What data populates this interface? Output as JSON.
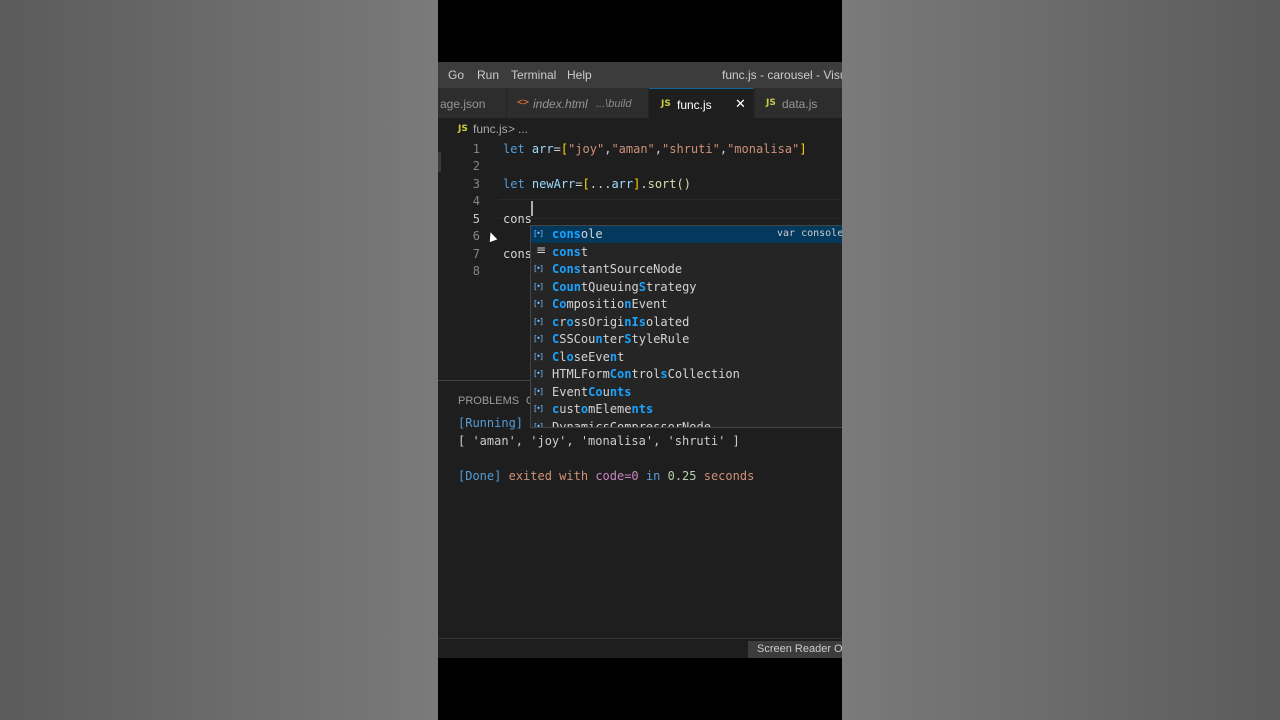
{
  "menubar": {
    "items": [
      "Go",
      "Run",
      "Terminal",
      "Help"
    ],
    "window_title": "func.js - carousel - Visual S"
  },
  "tabs": [
    {
      "label": "age.json",
      "description": "",
      "icon": "json-icon",
      "active": false
    },
    {
      "label": "index.html",
      "description": "...\\build",
      "icon": "html-icon",
      "active": false
    },
    {
      "label": "func.js",
      "description": "",
      "icon": "js-icon",
      "active": true
    },
    {
      "label": "data.js",
      "description": "",
      "icon": "js-icon",
      "active": false
    }
  ],
  "icons": {
    "js": "JS",
    "html": "<>",
    "close": "✕"
  },
  "breadcrumb": {
    "file": "func.js",
    "separator": ">",
    "more": "..."
  },
  "editor": {
    "line_numbers": [
      "1",
      "2",
      "3",
      "4",
      "5",
      "6",
      "7",
      "8"
    ],
    "current_line": "5",
    "lines": {
      "l1": {
        "kw": "let",
        "var": "arr",
        "eq": "=",
        "open": "[",
        "s1": "\"joy\"",
        "s2": "\"aman\"",
        "s3": "\"shruti\"",
        "s4": "\"monalisa\"",
        "comma": ",",
        "close": "]"
      },
      "l3": {
        "kw": "let",
        "var": "newArr",
        "eq": "=",
        "open": "[",
        "spread": "...",
        "var2": "arr",
        "close": "]",
        "dot": ".",
        "fn": "sort",
        "parens": "()"
      },
      "l5": "cons",
      "l7": "cons"
    }
  },
  "suggest": {
    "items": [
      {
        "match": "cons",
        "rest": "ole",
        "icon": "variable",
        "selected": true,
        "detail": "var console"
      },
      {
        "match": "cons",
        "rest": "t",
        "icon": "keyword",
        "selected": false,
        "detail": ""
      },
      {
        "match": "Cons",
        "rest": "tantSourceNode",
        "icon": "variable",
        "selected": false,
        "detail": ""
      },
      {
        "parts": [
          "Co",
          "u",
          "n",
          "tQueuing",
          "S",
          "trategy"
        ],
        "icon": "variable",
        "selected": false
      },
      {
        "parts": [
          "Co",
          "mpositio",
          "n",
          "Event",
          "",
          ""
        ],
        "icon": "variable",
        "selected": false
      },
      {
        "parts": [
          "c",
          "r",
          "o",
          "ssOrigi",
          "nIs",
          "olated"
        ],
        "icon": "variable",
        "selected": false
      },
      {
        "parts": [
          "C",
          "SSCou",
          "n",
          "ter",
          "S",
          "tyleRule"
        ],
        "icon": "variable",
        "selected": false
      },
      {
        "parts": [
          "C",
          "l",
          "o",
          "seEve",
          "n",
          "t"
        ],
        "icon": "variable",
        "selected": false
      },
      {
        "parts": [
          "",
          "HTMLForm",
          "Con",
          "trol",
          "s",
          "Collection"
        ],
        "icon": "variable",
        "selected": false
      },
      {
        "parts": [
          "",
          "Event",
          "Co",
          "u",
          "n",
          "ts"
        ],
        "icon": "variable",
        "selected": false
      },
      {
        "parts": [
          "c",
          "ust",
          "o",
          "mEleme",
          "n",
          "ts"
        ],
        "icon": "variable",
        "selected": false
      },
      {
        "plain": "DynamicsCompressorNode",
        "icon": "variable",
        "selected": false
      }
    ]
  },
  "panel": {
    "tabs": [
      "PROBLEMS",
      "O"
    ],
    "output": {
      "running": "[Running]",
      "result": "[ 'aman', 'joy', 'monalisa', 'shruti' ]",
      "done_tag": "[Done]",
      "done_exited": "exited with",
      "done_code": "code=0",
      "done_in": "in",
      "done_time": "0.25",
      "done_unit": "seconds"
    }
  },
  "statusbar": {
    "screen_reader": "Screen Reader Optimized"
  },
  "colors": {
    "accent": "#0e639c",
    "selection": "#04395e",
    "match": "#18a3ff"
  }
}
